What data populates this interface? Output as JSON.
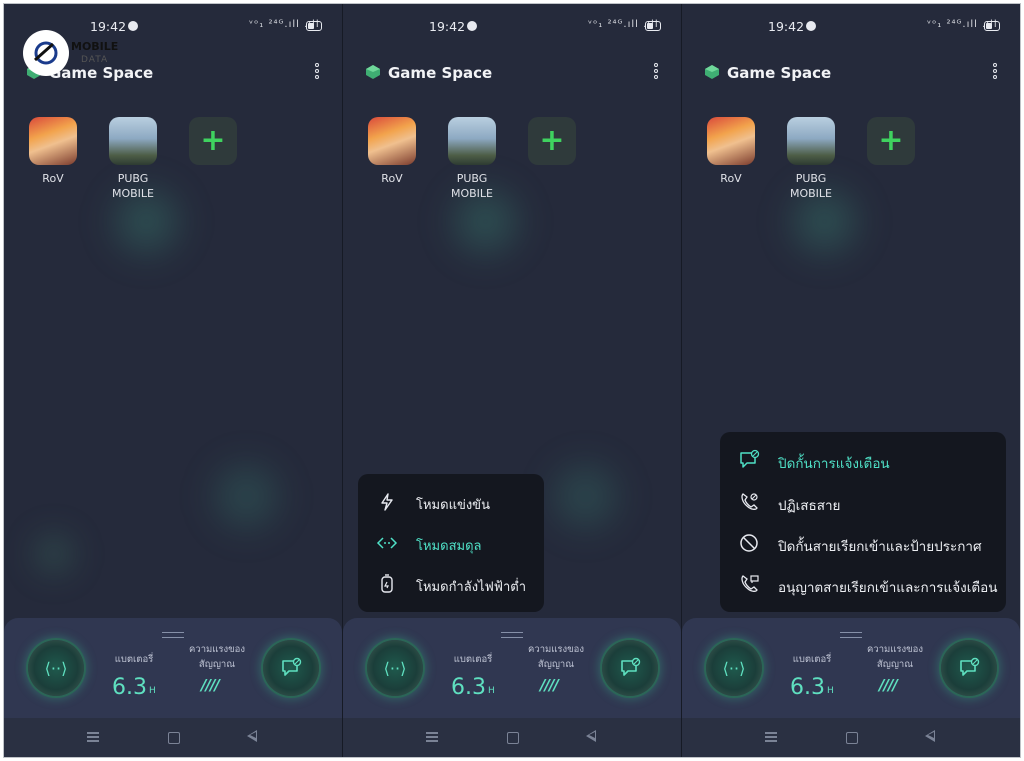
{
  "watermark": {
    "text1": "MOBILE",
    "text2": "DATA"
  },
  "status_bar": {
    "time": "19:42",
    "signal_text": "ᵛᵒ₁ ²⁴ᴳ.ıll .ıll"
  },
  "app": {
    "title": "Game Space"
  },
  "games": [
    {
      "label_line1": "RoV",
      "label_line2": ""
    },
    {
      "label_line1": "PUBG",
      "label_line2": "MOBILE"
    }
  ],
  "add_button": {
    "symbol": "+"
  },
  "bottom_panel": {
    "battery_label": "แบตเตอรี่",
    "battery_value": "6.3",
    "battery_unit": "H",
    "signal_label_line1": "ความแรงของ",
    "signal_label_line2": "สัญญาณ",
    "signal_bars": "////",
    "mode_symbol": "⟨··⟩"
  },
  "mode_menu": {
    "items": [
      {
        "label": "โหมดแข่งขัน",
        "icon": "lightning-icon",
        "active": false
      },
      {
        "label": "โหมดสมดุล",
        "icon": "balance-icon",
        "active": true
      },
      {
        "label": "โหมดกำลังไฟฟ้าต่ำ",
        "icon": "low-power-icon",
        "active": false
      }
    ]
  },
  "notification_menu": {
    "items": [
      {
        "label": "ปิดกั้นการแจ้งเตือน",
        "icon": "chat-block-icon",
        "active": true
      },
      {
        "label": "ปฏิเสธสาย",
        "icon": "call-reject-icon",
        "active": false
      },
      {
        "label": "ปิดกั้นสายเรียกเข้าและป้ายประกาศ",
        "icon": "block-icon",
        "active": false
      },
      {
        "label": "อนุญาตสายเรียกเข้าและการแจ้งเตือน",
        "icon": "call-allow-icon",
        "active": false
      }
    ]
  },
  "colors": {
    "background": "#252a3b",
    "accent": "#4fe0c6",
    "add_green": "#3fd25f",
    "popup": "#14171f"
  }
}
